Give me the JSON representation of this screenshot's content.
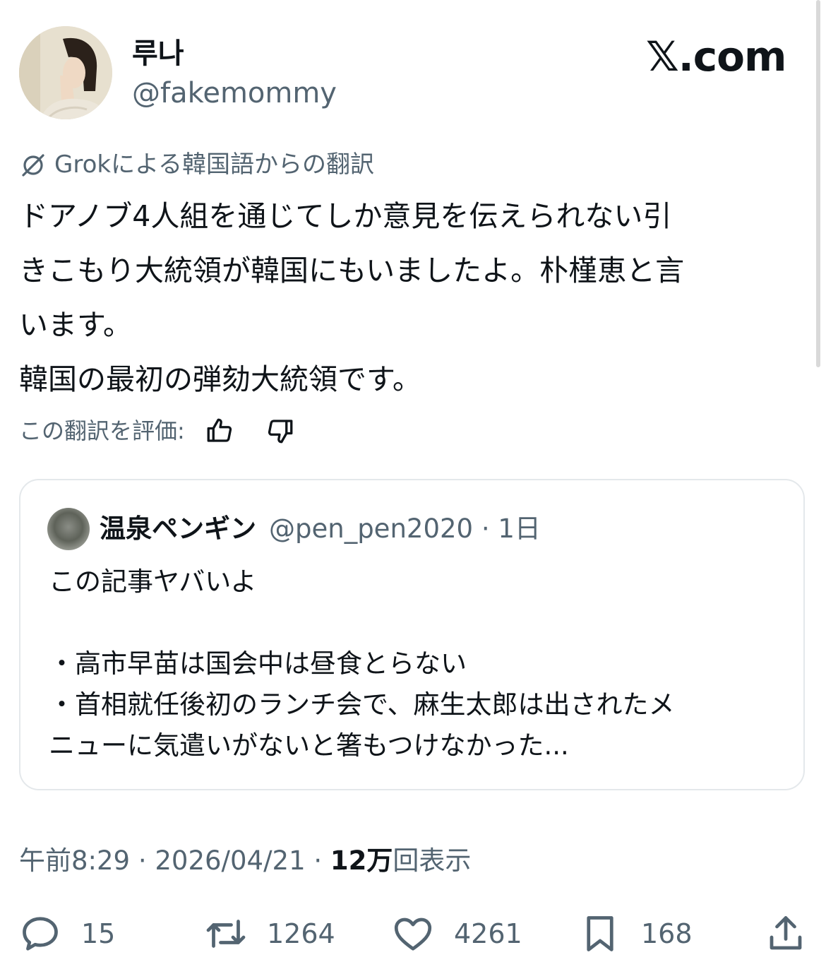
{
  "header": {
    "display_name": "루나",
    "handle": "@fakemommy",
    "brand": "𝕏.com"
  },
  "translation": {
    "label": "Grokによる韓国語からの翻訳"
  },
  "tweet": {
    "lines": [
      "ドアノブ4人組を通じてしか意見を伝えられない引",
      "きこもり大統領が韓国にもいましたよ。朴槿恵と言",
      "います。",
      "韓国の最初の弾劾大統領です。"
    ]
  },
  "rate": {
    "label": "この翻訳を評価:"
  },
  "quote": {
    "name": "温泉ペンギン",
    "handle_time": "@pen_pen2020 · 1日",
    "line1": "この記事ヤバいよ",
    "line2": "・高市早苗は国会中は昼食とらない",
    "line3": "・首相就任後初のランチ会で、麻生太郎は出されたメ",
    "line4": "ニューに気遣いがないと箸もつけなかった..."
  },
  "meta": {
    "time": "午前8:29 · 2026/04/21 · ",
    "views_count": "12万",
    "views_label": "回表示"
  },
  "actions": {
    "replies": "15",
    "reposts": "1264",
    "likes": "4261",
    "bookmarks": "168"
  }
}
